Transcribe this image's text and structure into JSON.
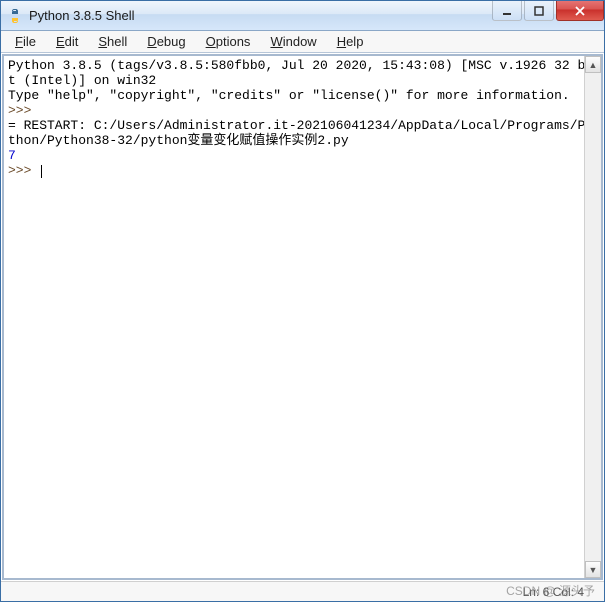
{
  "window": {
    "title": "Python 3.8.5 Shell"
  },
  "menubar": {
    "items": [
      {
        "label": "File",
        "key": "F"
      },
      {
        "label": "Edit",
        "key": "E"
      },
      {
        "label": "Shell",
        "key": "S"
      },
      {
        "label": "Debug",
        "key": "D"
      },
      {
        "label": "Options",
        "key": "O"
      },
      {
        "label": "Window",
        "key": "W"
      },
      {
        "label": "Help",
        "key": "H"
      }
    ]
  },
  "console": {
    "banner1": "Python 3.8.5 (tags/v3.8.5:580fbb0, Jul 20 2020, 15:43:08) [MSC v.1926 32 bit (Intel)] on win32",
    "banner2": "Type \"help\", \"copyright\", \"credits\" or \"license()\" for more information.",
    "prompt": ">>>",
    "restart_line": "= RESTART: C:/Users/Administrator.it-202106041234/AppData/Local/Programs/Python/Python38-32/python变量变化赋值操作实例2.py",
    "output": "7"
  },
  "statusbar": {
    "text": "Ln: 6  Col: 4"
  },
  "watermark": "CSDN @ 源头予"
}
